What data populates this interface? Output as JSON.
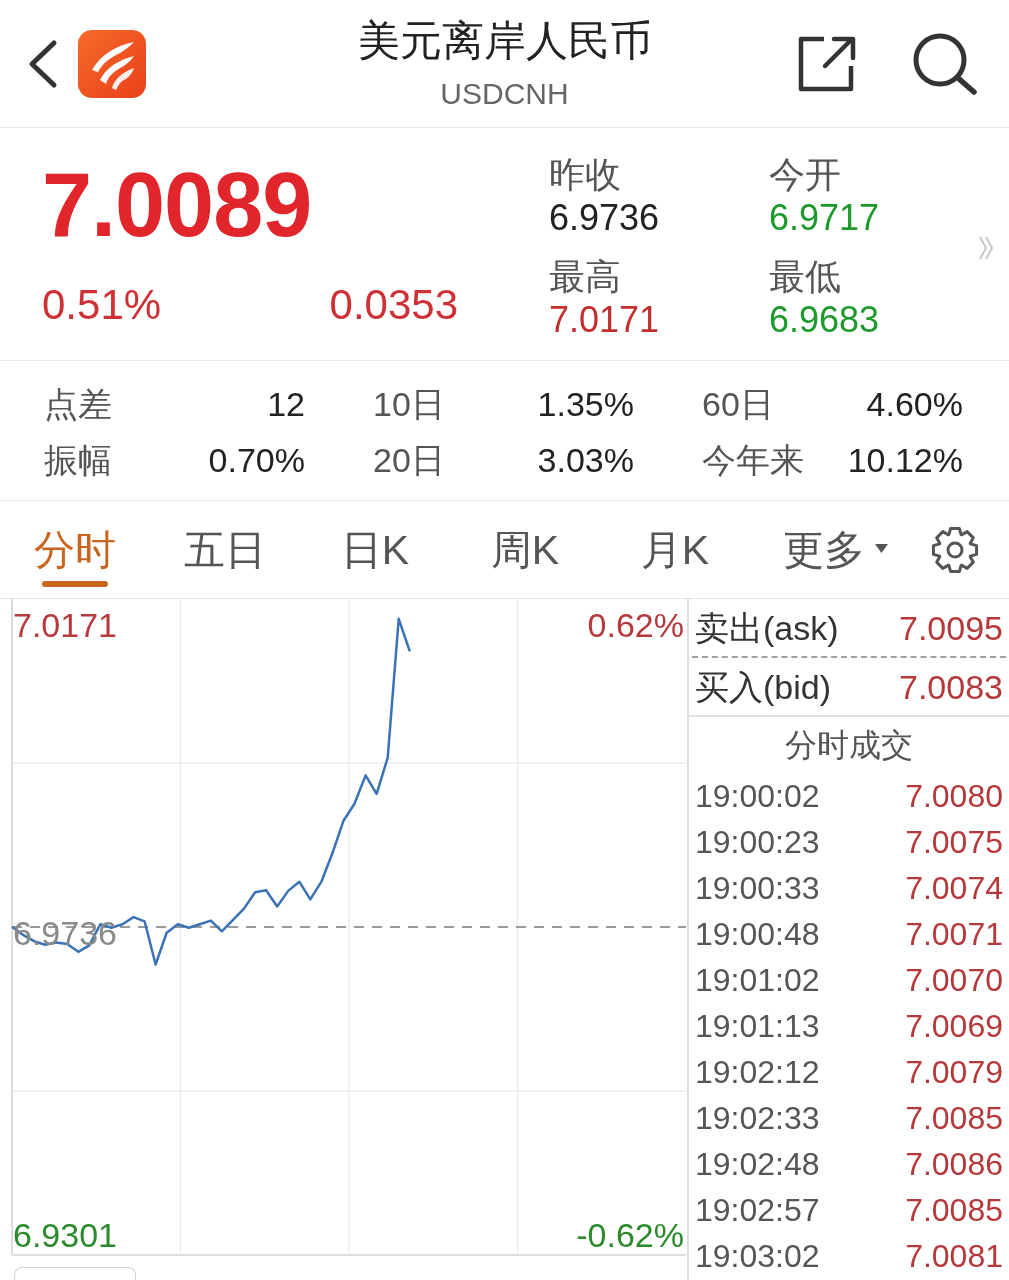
{
  "header": {
    "title": "美元离岸人民币",
    "subtitle": "USDCNH"
  },
  "quote": {
    "price": "7.0089",
    "change_percent": "0.51%",
    "change": "0.0353",
    "rising": true,
    "fields": [
      {
        "label": "昨收",
        "value": "6.9736",
        "color": "#222222"
      },
      {
        "label": "今开",
        "value": "6.9717",
        "color": "#1e9a2c"
      },
      {
        "label": "最高",
        "value": "7.0171",
        "color": "#c0302f"
      },
      {
        "label": "最低",
        "value": "6.9683",
        "color": "#1e9a2c"
      }
    ]
  },
  "stats": [
    {
      "label": "点差",
      "value": "12"
    },
    {
      "label": "10日",
      "value": "1.35%"
    },
    {
      "label": "60日",
      "value": "4.60%"
    },
    {
      "label": "振幅",
      "value": "0.70%"
    },
    {
      "label": "20日",
      "value": "3.03%"
    },
    {
      "label": "今年来",
      "value": "10.12%"
    }
  ],
  "tabs": [
    {
      "label": "分时",
      "selected": true,
      "kind": "tab"
    },
    {
      "label": "五日",
      "selected": false,
      "kind": "tab"
    },
    {
      "label": "日K",
      "selected": false,
      "kind": "tab"
    },
    {
      "label": "周K",
      "selected": false,
      "kind": "tab"
    },
    {
      "label": "月K",
      "selected": false,
      "kind": "tab"
    },
    {
      "label": "更多",
      "selected": false,
      "kind": "dropdown"
    }
  ],
  "chart": {
    "right_axis_labels": [
      "0.62%",
      "-0.62%"
    ],
    "chart_data": {
      "type": "line",
      "values": [
        6.9736,
        6.9725,
        6.9716,
        6.9711,
        6.9714,
        6.9712,
        6.9701,
        6.971,
        6.974,
        6.9735,
        6.974,
        6.975,
        6.9744,
        6.9683,
        6.9728,
        6.974,
        6.9735,
        6.974,
        6.9745,
        6.973,
        6.9746,
        6.9762,
        6.9785,
        6.9788,
        6.9765,
        6.9787,
        6.98,
        6.9775,
        6.98,
        6.984,
        6.9886,
        6.991,
        6.995,
        6.9924,
        6.9975,
        7.0171,
        7.0125,
        null,
        null,
        null,
        null,
        null,
        null,
        null,
        null,
        null,
        null,
        null,
        null,
        null,
        null,
        null,
        null,
        null,
        null,
        null,
        null,
        null,
        null,
        null,
        null,
        null
      ],
      "ylim": [
        6.9273,
        7.0199
      ],
      "yticks": [
        7.0171,
        6.9301
      ],
      "ref_lines": [
        {
          "axis": "y",
          "value": 6.9736,
          "label": "6.9736"
        }
      ]
    }
  },
  "quotes_panel": {
    "order_book": [
      {
        "label": "卖出(ask)",
        "value": "7.0095"
      },
      {
        "label": "买入(bid)",
        "value": "7.0083"
      }
    ],
    "trades_title": "分时成交",
    "trades": [
      {
        "time": "19:00:02",
        "price": "7.0080"
      },
      {
        "time": "19:00:23",
        "price": "7.0075"
      },
      {
        "time": "19:00:33",
        "price": "7.0074"
      },
      {
        "time": "19:00:48",
        "price": "7.0071"
      },
      {
        "time": "19:01:02",
        "price": "7.0070"
      },
      {
        "time": "19:01:13",
        "price": "7.0069"
      },
      {
        "time": "19:02:12",
        "price": "7.0079"
      },
      {
        "time": "19:02:33",
        "price": "7.0085"
      },
      {
        "time": "19:02:48",
        "price": "7.0086"
      },
      {
        "time": "19:02:57",
        "price": "7.0085"
      },
      {
        "time": "19:03:02",
        "price": "7.0081"
      }
    ]
  }
}
